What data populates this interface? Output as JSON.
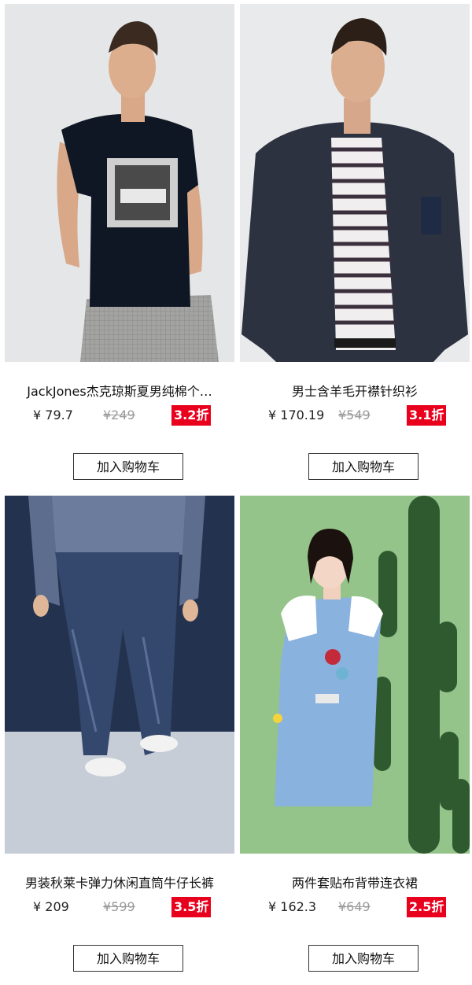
{
  "products": [
    {
      "title": "JackJones杰克琼斯夏男纯棉个…",
      "price": "¥ 79.7",
      "old_price": "¥249",
      "discount": "3.2折",
      "button": "加入购物车",
      "photo": "man-in-black-graphic-tshirt"
    },
    {
      "title": "男士含羊毛开襟针织衫",
      "price": "¥ 170.19",
      "old_price": "¥549",
      "discount": "3.1折",
      "button": "加入购物车",
      "photo": "man-in-navy-cardigan"
    },
    {
      "title": "男装秋莱卡弹力休闲直筒牛仔长裤",
      "price": "¥ 209",
      "old_price": "¥599",
      "discount": "3.5折",
      "button": "加入购物车",
      "photo": "man-in-denim-jeans"
    },
    {
      "title": "两件套贴布背带连衣裙",
      "price": "¥ 162.3",
      "old_price": "¥649",
      "discount": "2.5折",
      "button": "加入购物车",
      "photo": "woman-in-denim-pinafore-dress"
    }
  ],
  "colors": {
    "discount_bg": "#e8001c",
    "old_price": "#9a9a9a",
    "button_border": "#333333"
  }
}
